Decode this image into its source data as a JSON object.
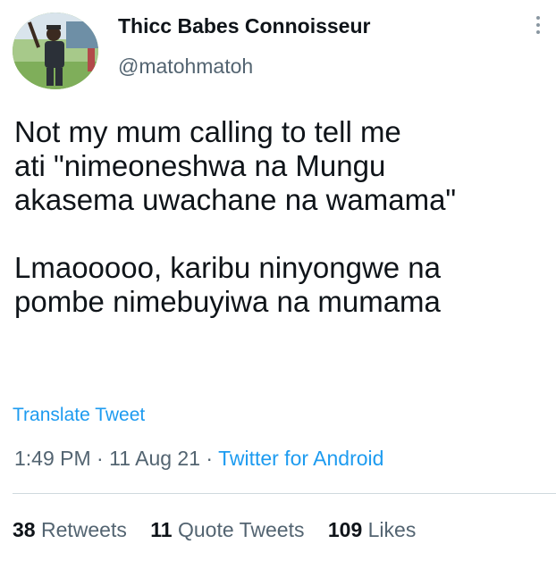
{
  "author": {
    "display_name": "Thicc Babes Connoisseur",
    "handle": "@matohmatoh"
  },
  "tweet": {
    "lines_para1": [
      "Not my mum calling to tell me",
      "ati \"nimeoneshwa na Mungu",
      "akasema uwachane na wamama\""
    ],
    "lines_para2": [
      "Lmaooooo, karibu ninyongwe na",
      "pombe nimebuyiwa na mumama"
    ],
    "translate_label": "Translate Tweet",
    "time": "1:49 PM",
    "date": "11 Aug 21",
    "source": "Twitter for Android",
    "separator": "·"
  },
  "stats": {
    "retweets_count": "38",
    "retweets_label": "Retweets",
    "quotes_count": "11",
    "quotes_label": "Quote Tweets",
    "likes_count": "109",
    "likes_label": "Likes"
  },
  "icons": {
    "more": "more-vertical-icon"
  },
  "colors": {
    "link": "#1d9bf0",
    "secondary_text": "#536471",
    "primary_text": "#0f1419",
    "divider": "#cfd9de"
  }
}
